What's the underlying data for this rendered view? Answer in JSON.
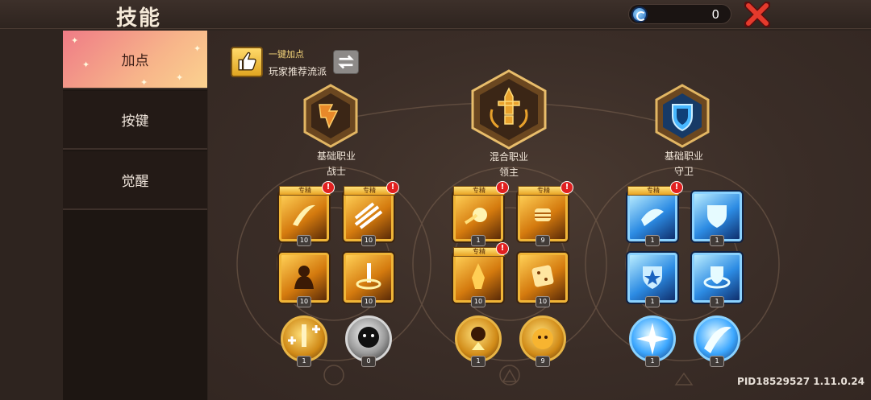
{
  "header": {
    "title": "技能",
    "currency_value": "0",
    "currency_icon": "blue-gem-icon"
  },
  "sidebar": {
    "tabs": [
      {
        "label": "加点",
        "active": true
      },
      {
        "label": "按键",
        "active": false
      },
      {
        "label": "觉醒",
        "active": false
      }
    ]
  },
  "recommend": {
    "label_top": "一键加点",
    "label_bottom": "玩家推荐流派"
  },
  "classes": [
    {
      "type": "基础职业",
      "name": "战士",
      "color": "#e59a2a"
    },
    {
      "type": "混合职业",
      "name": "领主",
      "color": "#e59a2a"
    },
    {
      "type": "基础职业",
      "name": "守卫",
      "color": "#3aa3f0"
    }
  ],
  "skills": {
    "tag": "专精",
    "alert": "!",
    "levels": {
      "warrior": [
        "10",
        "10",
        "10",
        "10"
      ],
      "lord": [
        "1",
        "9",
        "10",
        "10"
      ],
      "guard": [
        "1",
        "1",
        "1",
        "1"
      ]
    },
    "passives": [
      "1",
      "0",
      "1",
      "9",
      "1",
      "1"
    ]
  },
  "footer": {
    "pid": "PID18529527 1.11.0.24"
  }
}
